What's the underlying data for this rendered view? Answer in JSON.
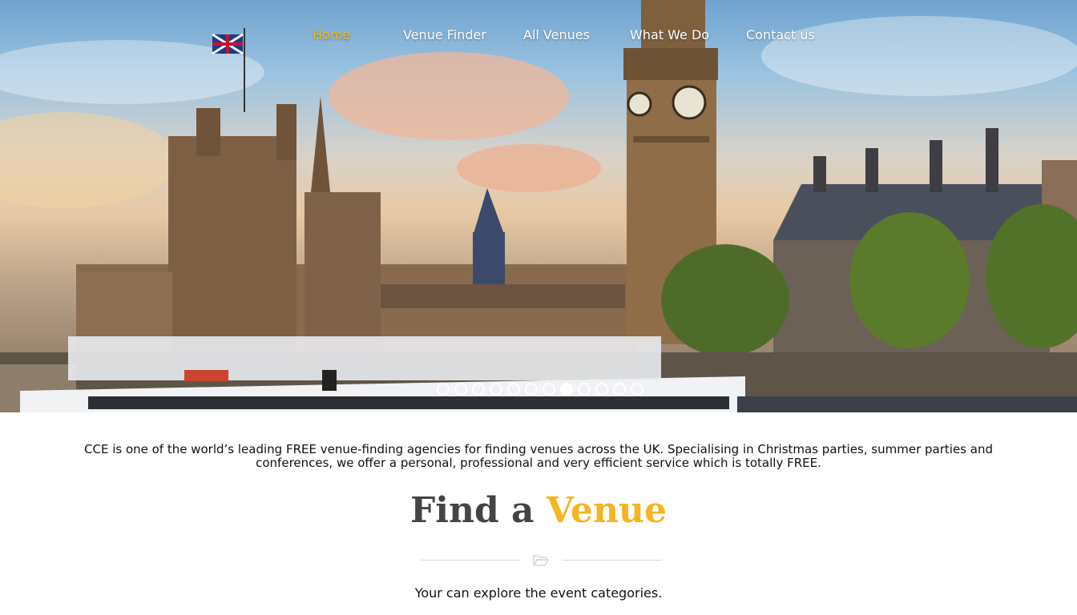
{
  "nav": {
    "items": [
      {
        "label": "Home",
        "active": true
      },
      {
        "label": "Venue Finder",
        "active": false
      },
      {
        "label": "All Venues",
        "active": false
      },
      {
        "label": "What We Do",
        "active": false
      },
      {
        "label": "Contact us",
        "active": false
      }
    ]
  },
  "slider": {
    "slide_count": 12,
    "active_index": 7
  },
  "intro": {
    "text": "CCE is one of the world’s leading FREE venue-finding agencies for finding venues across the UK. Specialising in Christmas parties, summer parties and conferences, we offer a personal, professional and very efficient service which is totally FREE."
  },
  "section": {
    "title_part1": "Find a",
    "title_part2": "Venue",
    "divider_icon": "folder-open-icon",
    "subtitle": "Your can explore the event categories."
  },
  "colors": {
    "accent": "#f3b61f",
    "heading_dark": "#444444",
    "text": "#111111"
  }
}
